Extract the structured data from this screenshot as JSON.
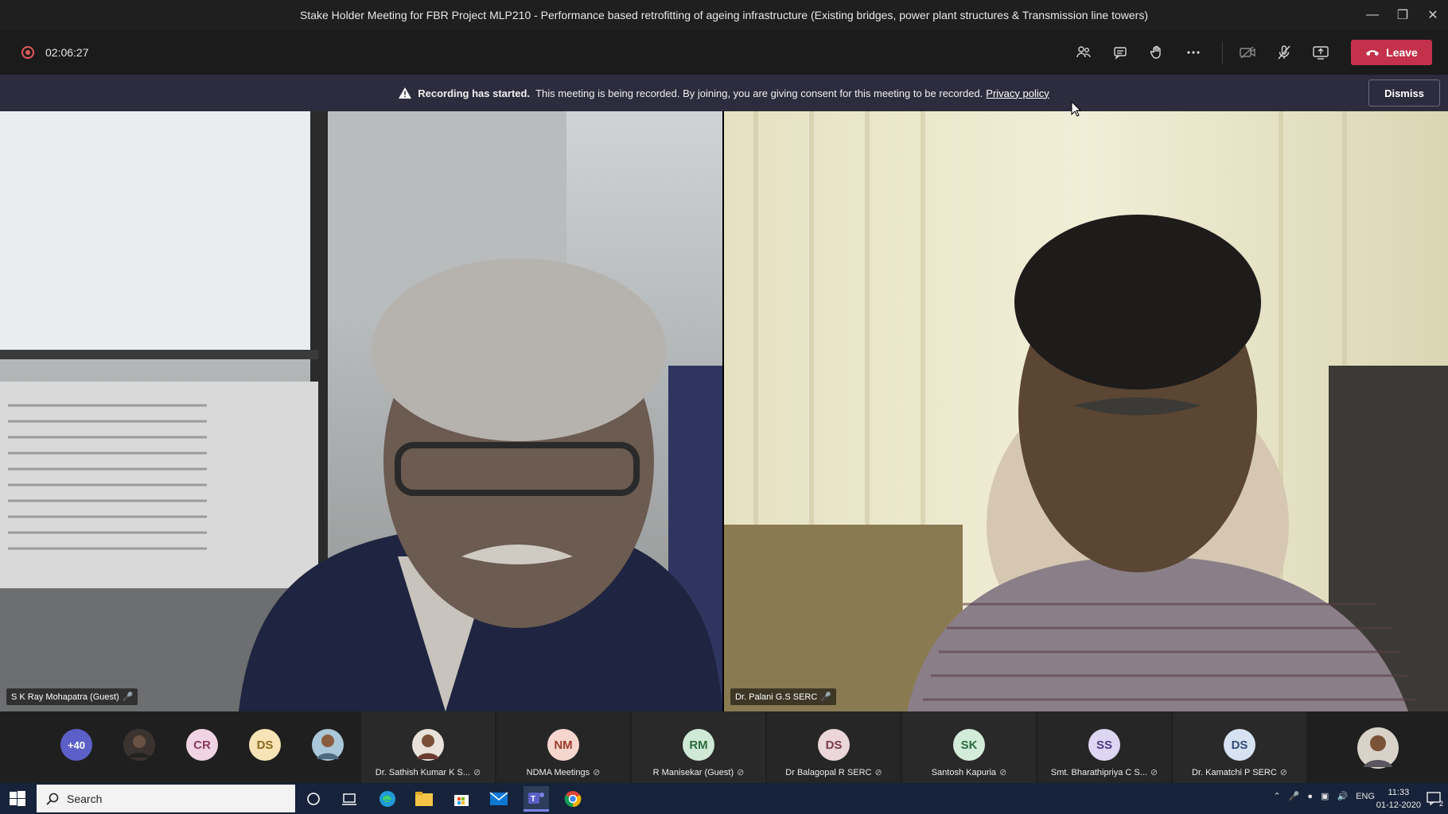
{
  "window": {
    "title": "Stake Holder Meeting for FBR Project MLP210 - Performance based retrofitting of ageing infrastructure (Existing bridges, power plant structures & Transmission line towers)",
    "controls": [
      "minimize-icon",
      "restore-icon",
      "close-icon"
    ]
  },
  "toolbar": {
    "timer": "02:06:27",
    "icons": [
      "participants-icon",
      "chat-icon",
      "raise-hand-icon",
      "more-options-icon",
      "camera-off-icon",
      "mic-off-icon",
      "share-screen-icon"
    ],
    "leave_label": "Leave"
  },
  "banner": {
    "bold": "Recording has started.",
    "text": "This meeting is being recorded. By joining, you are giving consent for this meeting to be recorded.",
    "link": "Privacy policy",
    "dismiss_label": "Dismiss"
  },
  "videos": [
    {
      "name": "S K Ray Mohapatra (Guest)"
    },
    {
      "name": "Dr. Palani G.S SERC"
    }
  ],
  "participants": {
    "overflow": "+40",
    "small": [
      {
        "initials": "",
        "kind": "photo"
      },
      {
        "initials": "CR",
        "color": "#f1d4e3",
        "fg": "#8a3a62"
      },
      {
        "initials": "DS",
        "color": "#f7e3b5",
        "fg": "#8a6a1a"
      },
      {
        "initials": "",
        "kind": "photo"
      }
    ],
    "labeled": [
      {
        "initials": "",
        "kind": "photo",
        "name": "Dr. Sathish Kumar K S..."
      },
      {
        "initials": "NM",
        "color": "#f6d6cf",
        "fg": "#9a3b2a",
        "name": "NDMA Meetings"
      },
      {
        "initials": "RM",
        "color": "#cfe9d6",
        "fg": "#2d6a3e",
        "name": "R Manisekar (Guest)"
      },
      {
        "initials": "DS",
        "color": "#ebd6da",
        "fg": "#7a3a46",
        "name": "Dr Balagopal R SERC"
      },
      {
        "initials": "SK",
        "color": "#d2ecd9",
        "fg": "#2d6a3e",
        "name": "Santosh Kapuria"
      },
      {
        "initials": "SS",
        "color": "#ddd6f2",
        "fg": "#4b3a8a",
        "name": "Smt. Bharathipriya C S..."
      },
      {
        "initials": "DS",
        "color": "#d6e2f1",
        "fg": "#2e4a78",
        "name": "Dr. Kamatchi P SERC"
      }
    ]
  },
  "taskbar": {
    "search_label": "Search",
    "lang": "ENG",
    "time": "11:33",
    "date": "01-12-2020",
    "notifications": "2"
  }
}
